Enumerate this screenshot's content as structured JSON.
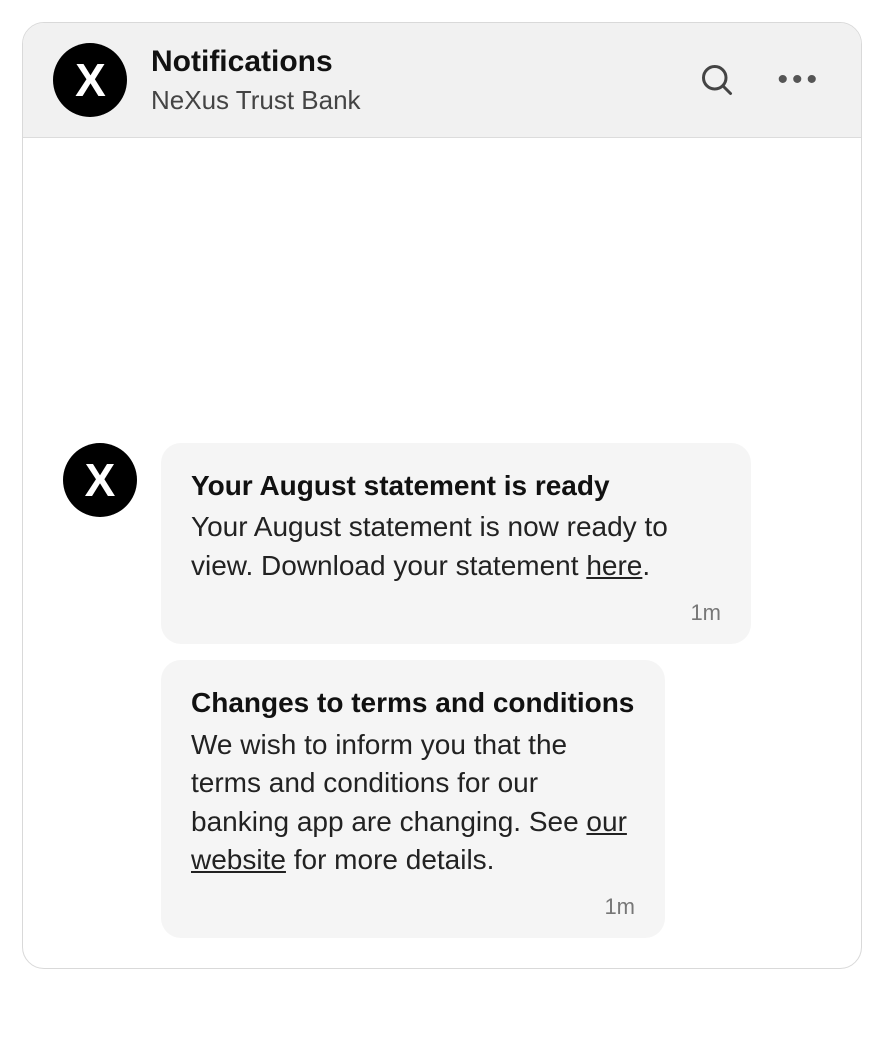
{
  "header": {
    "avatar_letter": "X",
    "title": "Notifications",
    "subtitle": "NeXus Trust Bank"
  },
  "thread": {
    "avatar_letter": "X",
    "messages": [
      {
        "title": "Your August statement is ready",
        "body_pre": "Your August statement is now ready to view. Download your statement ",
        "link_text": "here",
        "body_post": ".",
        "time": "1m"
      },
      {
        "title": "Changes to terms and conditions",
        "body_pre": "We wish to inform you that the terms and conditions for our banking app are changing. See ",
        "link_text": "our website",
        "body_post": " for more details.",
        "time": "1m"
      }
    ]
  }
}
